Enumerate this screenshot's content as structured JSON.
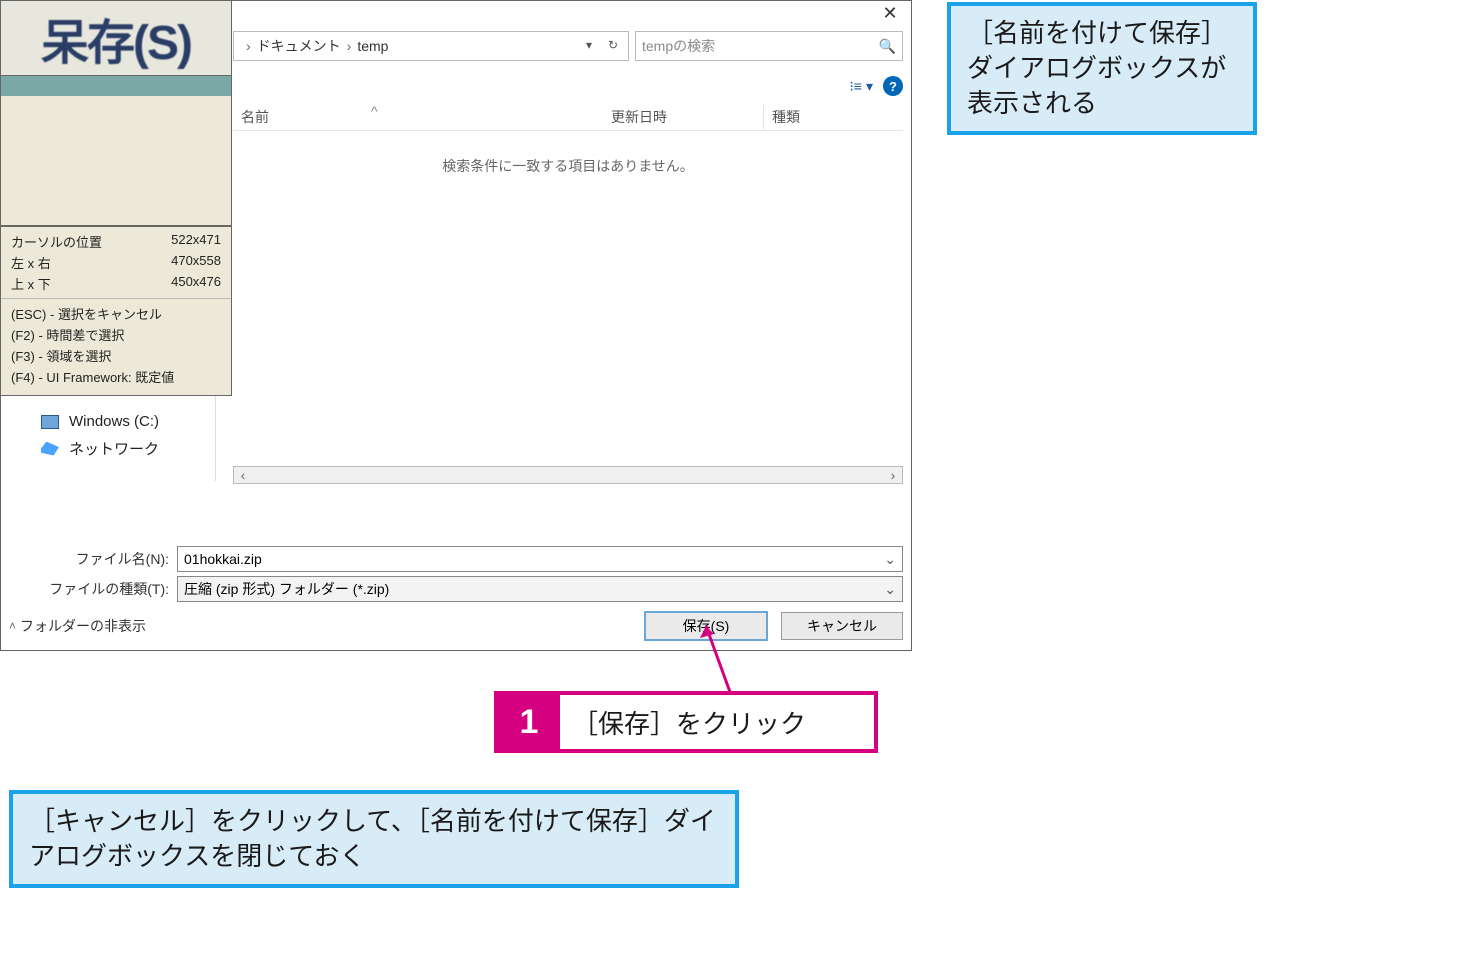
{
  "dialog": {
    "close_char": "✕",
    "breadcrumb": {
      "seg1": "ドキュメント",
      "seg2": "temp"
    },
    "addr_dropdown_char": "▾",
    "refresh_char": "↻",
    "search_placeholder": "tempの検索",
    "view_dropdown_char": "▾",
    "help_char": "?",
    "columns": {
      "name": "名前",
      "date": "更新日時",
      "kind": "種類",
      "sort_char": "^"
    },
    "empty_message": "検索条件に一致する項目はありません。",
    "side_items": {
      "drive": "Windows (C:)",
      "network": "ネットワーク"
    },
    "filename_label": "ファイル名(N):",
    "filename_value": "01hokkai.zip",
    "filetype_label": "ファイルの種類(T):",
    "filetype_value": "圧縮 (zip 形式) フォルダー (*.zip)",
    "hide_folders": "フォルダーの非表示",
    "save_btn": "保存(S)",
    "cancel_btn": "キャンセル",
    "dd_char": "⌄",
    "hscroll_left": "‹",
    "hscroll_right": "›"
  },
  "overlay": {
    "title_fragment": "呆存(S)",
    "stats": {
      "cursor_label": "カーソルの位置",
      "cursor_val": "522x471",
      "lr_label": "左 x 右",
      "lr_val": "470x558",
      "tb_label": "上 x 下",
      "tb_val": "450x476"
    },
    "keys": {
      "esc": "(ESC) - 選択をキャンセル",
      "f2": "(F2)   - 時間差で選択",
      "f3": "(F3)   - 領域を選択",
      "f4": "(F4)   - UI Framework: 既定値"
    }
  },
  "callouts": {
    "top": "［名前を付けて保存］ダイアログボックスが表示される",
    "step_num": "1",
    "step_text": "［保存］をクリック",
    "bottom": "［キャンセル］をクリックして、［名前を付けて保存］ダイアログボックスを閉じておく"
  },
  "aux": {
    "view_icon": "⁝≡"
  }
}
